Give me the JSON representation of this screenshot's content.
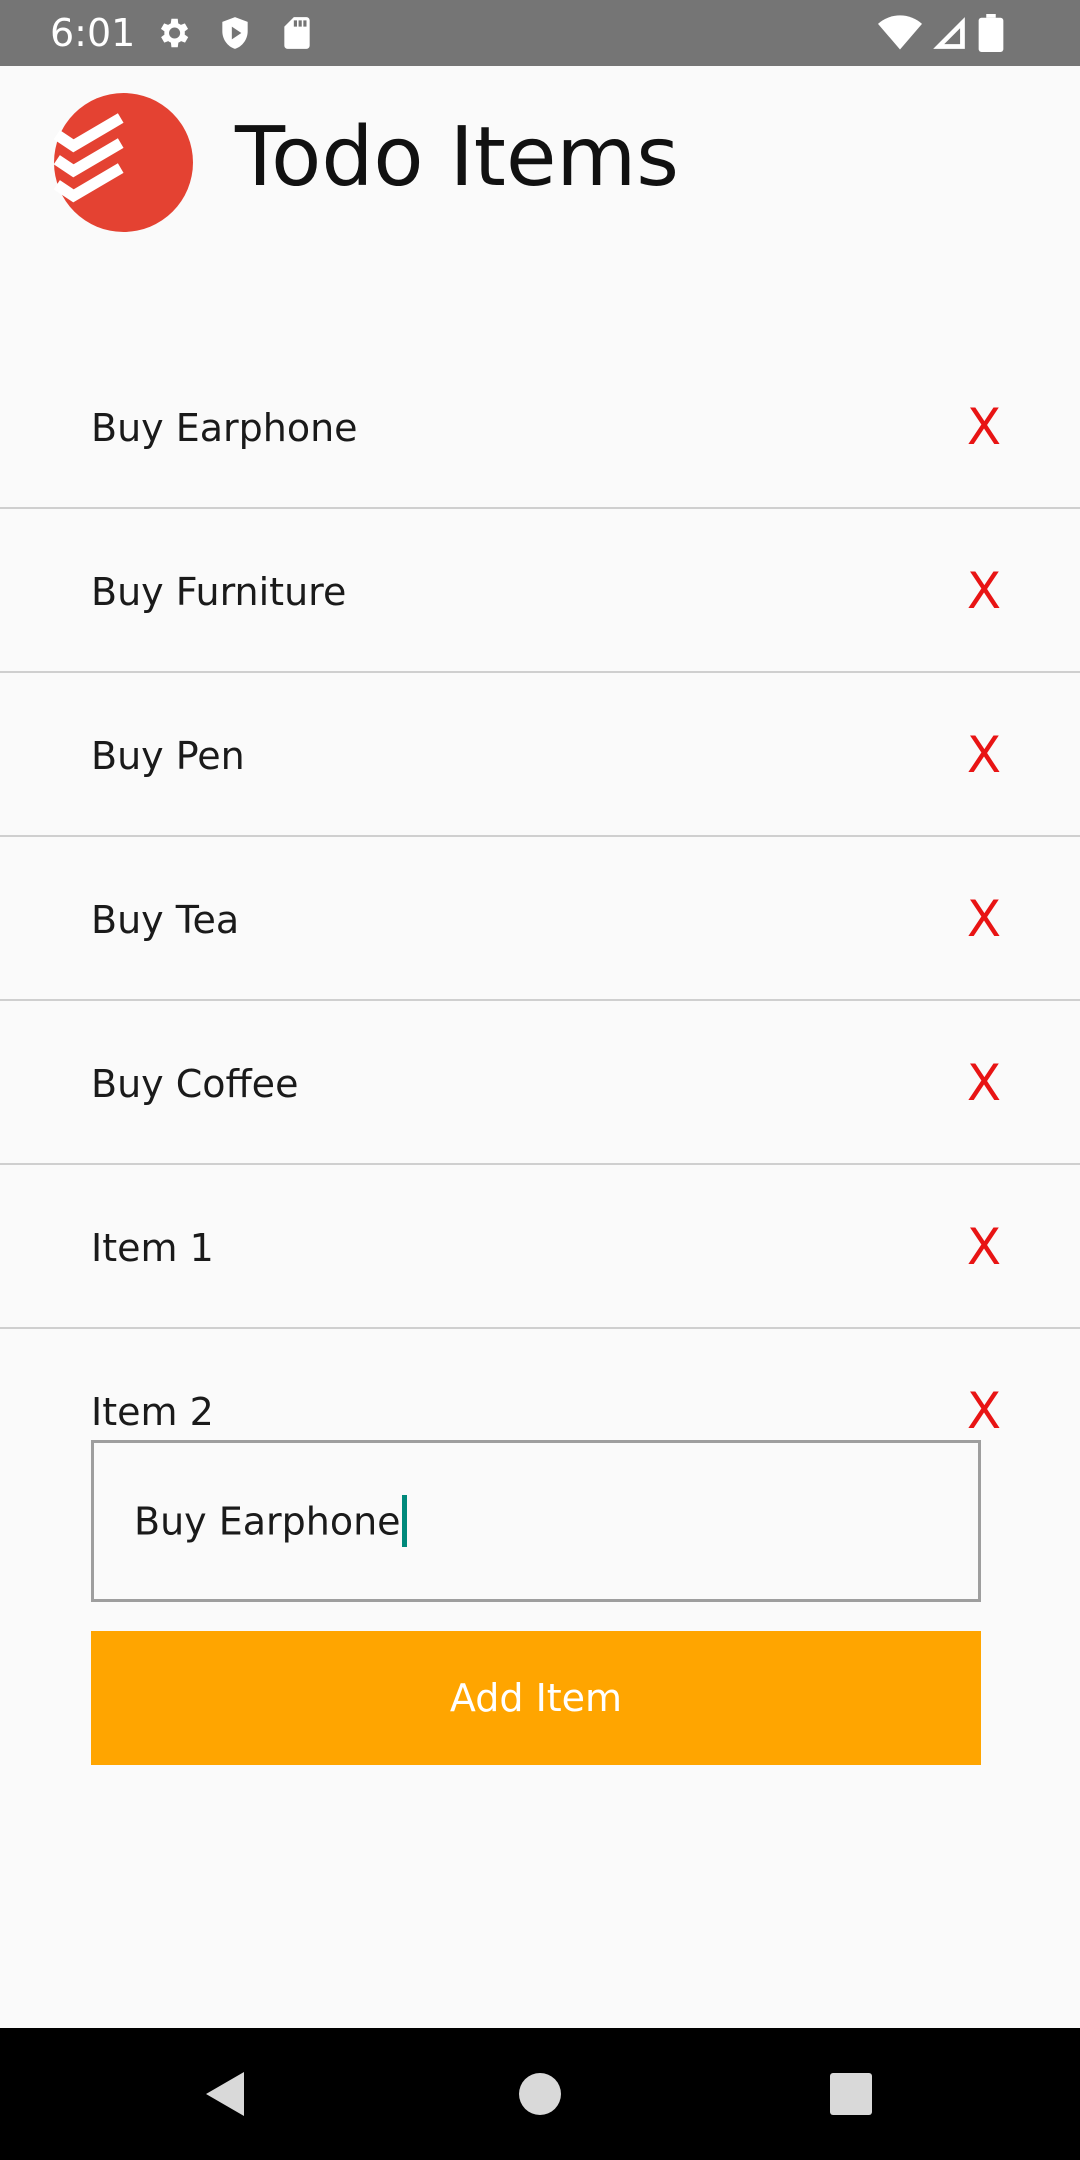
{
  "status_bar": {
    "time": "6:01",
    "left_icons": [
      "settings-gear-icon",
      "shield-play-icon",
      "sd-card-icon"
    ],
    "right_icons": [
      "wifi-icon",
      "cellular-signal-icon",
      "battery-icon"
    ]
  },
  "header": {
    "title": "Todo Items",
    "logo_icon": "todoist-logo-icon",
    "logo_color": "#e44232"
  },
  "todo_list": {
    "items": [
      {
        "label": "Buy Earphone",
        "delete_label": "X"
      },
      {
        "label": "Buy Furniture",
        "delete_label": "X"
      },
      {
        "label": "Buy Pen",
        "delete_label": "X"
      },
      {
        "label": "Buy Tea",
        "delete_label": "X"
      },
      {
        "label": "Buy Coffee",
        "delete_label": "X"
      },
      {
        "label": "Item 1",
        "delete_label": "X"
      },
      {
        "label": "Item 2",
        "delete_label": "X"
      }
    ]
  },
  "input": {
    "value": "Buy Earphone"
  },
  "add_button": {
    "label": "Add Item",
    "color": "#ffa500"
  },
  "nav_bar": {
    "buttons": [
      "back-triangle-icon",
      "home-circle-icon",
      "recents-square-icon"
    ]
  },
  "colors": {
    "delete": "#e81414",
    "status_bar": "#757575",
    "caret": "#00897b"
  }
}
